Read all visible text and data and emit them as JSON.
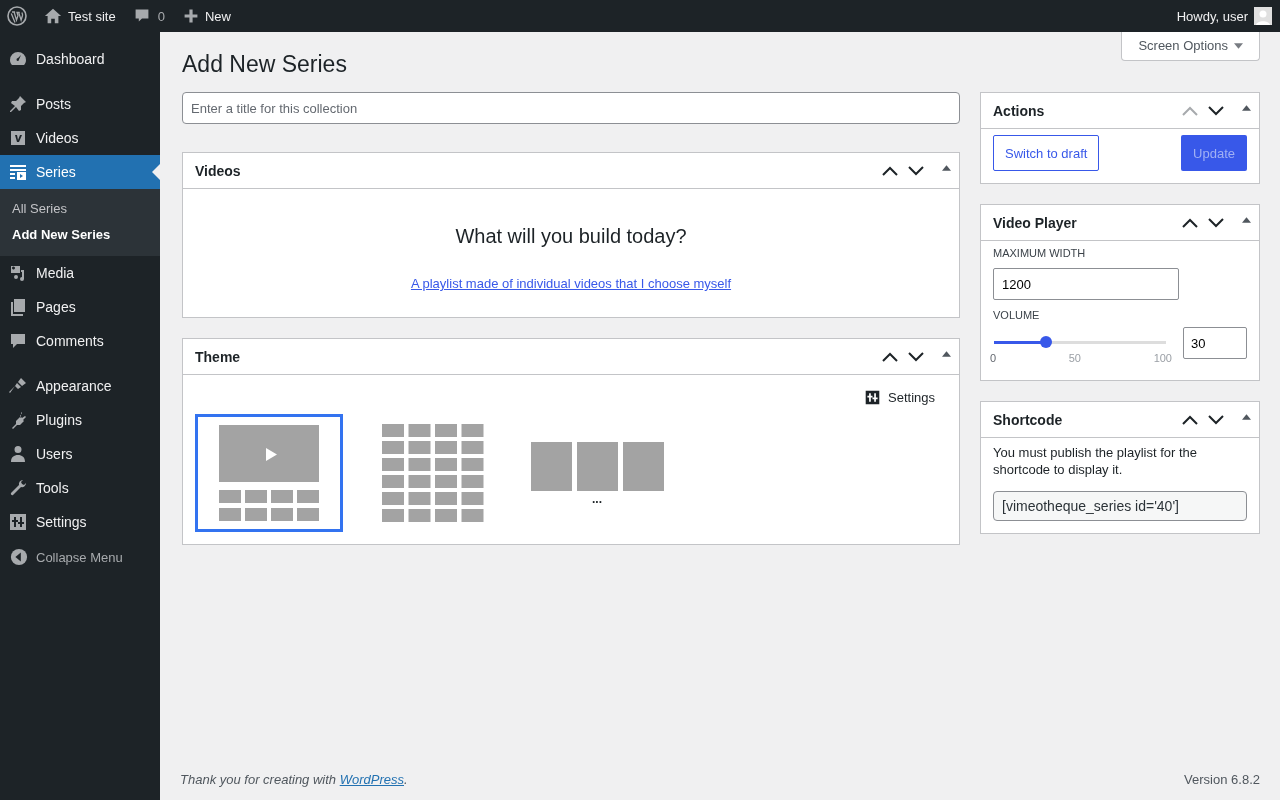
{
  "admin_bar": {
    "site": "Test site",
    "comments": "0",
    "new": "New",
    "greeting": "Howdy, user"
  },
  "menu_groups": [
    [
      {
        "label": "Dashboard",
        "selected": false
      }
    ],
    [
      {
        "label": "Posts",
        "selected": false
      },
      {
        "label": "Videos",
        "selected": false
      },
      {
        "label": "Series",
        "selected": true,
        "children": [
          {
            "label": "All Series",
            "selected": false
          },
          {
            "label": "Add New Series",
            "selected": true
          }
        ]
      },
      {
        "label": "Media",
        "selected": false
      },
      {
        "label": "Pages",
        "selected": false
      },
      {
        "label": "Comments",
        "selected": false
      }
    ],
    [
      {
        "label": "Appearance",
        "selected": false
      },
      {
        "label": "Plugins",
        "selected": false
      },
      {
        "label": "Users",
        "selected": false
      },
      {
        "label": "Tools",
        "selected": false
      },
      {
        "label": "Settings",
        "selected": false
      }
    ]
  ],
  "collapse_menu": "Collapse Menu",
  "screen_options": "Screen Options",
  "page_title": "Add New Series",
  "title_field": {
    "placeholder": "Enter a title for this collection"
  },
  "videos_box": {
    "title": "Videos",
    "move_up_disabled": false,
    "heading": "What will you build today?",
    "link": "A playlist made of individual videos that I choose myself"
  },
  "theme_box": {
    "title": "Theme",
    "move_up_disabled": false,
    "settings": "Settings",
    "layouts": [
      {
        "kind": "player",
        "selected": true
      },
      {
        "kind": "grid",
        "selected": false
      },
      {
        "kind": "carousel",
        "selected": false,
        "more": "..."
      }
    ]
  },
  "actions_box": {
    "title": "Actions",
    "move_up_disabled": true,
    "draft_button": "Switch to draft",
    "update_button": "Update",
    "update_disabled": true
  },
  "player_box": {
    "title": "Video Player",
    "move_up_disabled": false,
    "width_label": "MAXIMUM WIDTH",
    "width_value": "1200",
    "volume_label": "VOLUME",
    "volume": {
      "level": 0.3,
      "ticks": [
        "0",
        "50",
        "100"
      ],
      "value": "30"
    }
  },
  "shortcode_box": {
    "title": "Shortcode",
    "move_up_disabled": false,
    "note": "You must publish the playlist for the shortcode to display it.",
    "code": "[vimeotheque_series id='40']"
  },
  "footer": {
    "thanks_before": "Thank you for creating with ",
    "thanks_link": "WordPress",
    "thanks_after": ".",
    "version": "Version 6.8.2"
  }
}
